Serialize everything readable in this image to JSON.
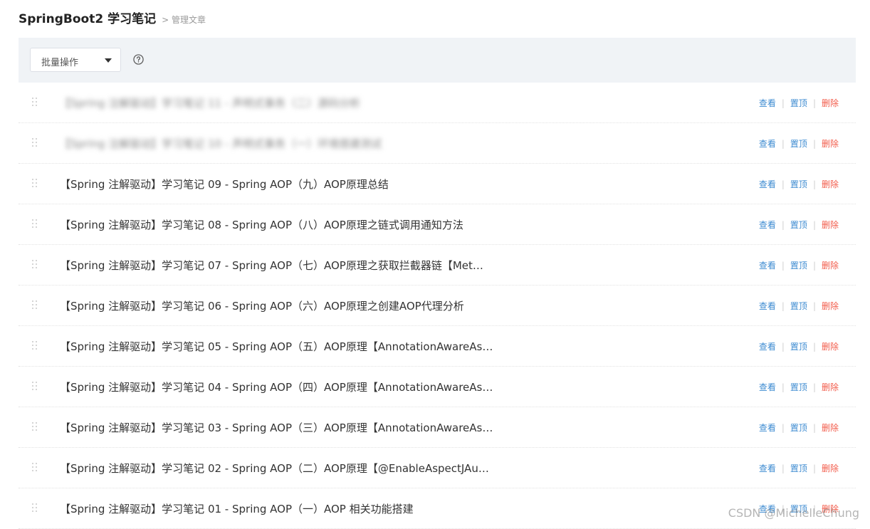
{
  "header": {
    "title": "SpringBoot2 学习笔记",
    "breadcrumb": "> 管理文章"
  },
  "toolbar": {
    "batch_label": "批量操作",
    "help_icon": "question-circle-icon"
  },
  "actions": {
    "view": "查看",
    "pin": "置顶",
    "delete": "删除",
    "sep": "|"
  },
  "articles": [
    {
      "title": "【Spring 注解驱动】学习笔记 11 - 声明式事务（二）源码分析",
      "blurred": true
    },
    {
      "title": "【Spring 注解驱动】学习笔记 10 - 声明式事务（一）环境搭建测试",
      "blurred": true
    },
    {
      "title": "【Spring 注解驱动】学习笔记 09 - Spring AOP（九）AOP原理总结",
      "blurred": false
    },
    {
      "title": "【Spring 注解驱动】学习笔记 08 - Spring AOP（八）AOP原理之链式调用通知方法",
      "blurred": false
    },
    {
      "title": "【Spring 注解驱动】学习笔记 07 - Spring AOP（七）AOP原理之获取拦截器链【Met…",
      "blurred": false
    },
    {
      "title": "【Spring 注解驱动】学习笔记 06 - Spring AOP（六）AOP原理之创建AOP代理分析",
      "blurred": false
    },
    {
      "title": "【Spring 注解驱动】学习笔记 05 - Spring AOP（五）AOP原理【AnnotationAwareAs…",
      "blurred": false
    },
    {
      "title": "【Spring 注解驱动】学习笔记 04 - Spring AOP（四）AOP原理【AnnotationAwareAs…",
      "blurred": false
    },
    {
      "title": "【Spring 注解驱动】学习笔记 03 - Spring AOP（三）AOP原理【AnnotationAwareAs…",
      "blurred": false
    },
    {
      "title": "【Spring 注解驱动】学习笔记 02 - Spring AOP（二）AOP原理【@EnableAspectJAu…",
      "blurred": false
    },
    {
      "title": "【Spring 注解驱动】学习笔记 01 - Spring AOP（一）AOP 相关功能搭建",
      "blurred": false
    }
  ],
  "watermark": "CSDN @MichelleChung",
  "colors": {
    "link": "#3d8bd1",
    "delete": "#f25b4a",
    "toolbar_bg": "#f0f3f6"
  }
}
